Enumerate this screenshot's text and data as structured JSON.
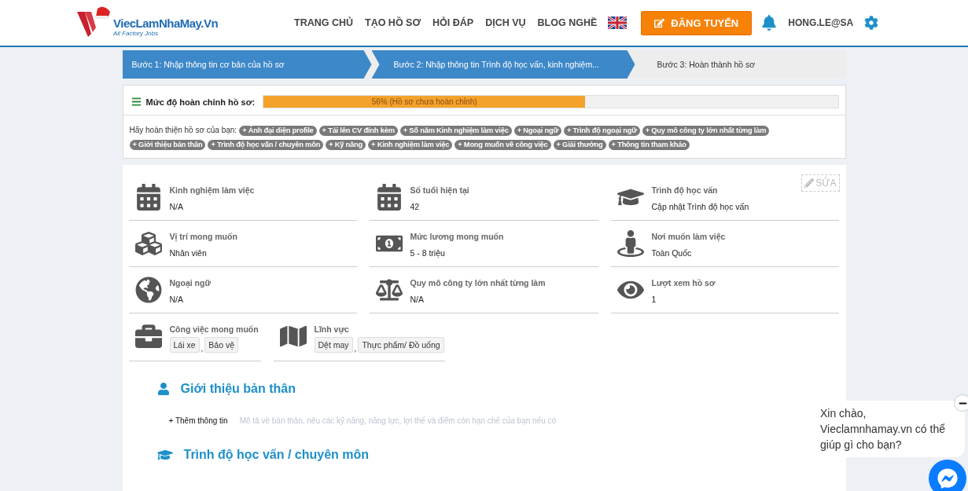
{
  "header": {
    "logo": {
      "name": "ViecLamNhaMay.Vn",
      "tagline": "All Factory Jobs"
    },
    "nav": [
      {
        "label": "TRANG CHỦ"
      },
      {
        "label": "TẠO HỒ SƠ"
      },
      {
        "label": "HỎI ĐÁP"
      },
      {
        "label": "DỊCH VỤ"
      },
      {
        "label": "BLOG NGHỀ"
      }
    ],
    "post_button": "ĐĂNG TUYỂN",
    "user": "HONG.LE@SA"
  },
  "steps": [
    {
      "label": "Bước 1: Nhập thông tin cơ bản của hồ sơ",
      "selected": true
    },
    {
      "label": "Bước 2: Nhập thông tin Trình độ học vấn, kinh nghiệm...",
      "selected": true
    },
    {
      "label": "Bước 3: Hoàn thành hồ sơ",
      "selected": false
    }
  ],
  "completion": {
    "label": "Mức độ hoàn chỉnh hồ sơ:",
    "level": 0.56,
    "reading": "56% (Hồ sơ chưa hoàn chỉnh)",
    "prompt": "Hãy hoàn thiện hồ sơ của bạn:",
    "tags": [
      "+ Ảnh đại diện profile",
      "+ Tải lên CV đính kèm",
      "+ Số năm Kinh nghiệm làm việc",
      "+ Ngoại ngữ",
      "+ Trình độ ngoại ngữ",
      "+ Quy mô công ty lớn nhất từng làm",
      "+ Giới thiệu bản thân",
      "+ Trình độ học vấn / chuyên môn",
      "+ Kỹ năng",
      "+ Kinh nghiệm làm việc",
      "+ Mong muốn về công việc",
      "+ Giải thưởng",
      "+ Thông tin tham khảo"
    ]
  },
  "profile": {
    "edit_button": "SỬA",
    "fields": [
      {
        "label": "Kinh nghiệm làm việc",
        "value": "N/A"
      },
      {
        "label": "Số tuổi hiện tại",
        "value": "42"
      },
      {
        "label": "Trình độ học vấn",
        "value": "Cập nhật Trình độ học vấn"
      },
      {
        "label": "Vị trí mong muốn",
        "value": "Nhân viên"
      },
      {
        "label": "Mức lương mong muốn",
        "value": "5 - 8 triệu"
      },
      {
        "label": "Nơi muốn làm việc",
        "value": "Toàn Quốc"
      },
      {
        "label": "Ngoại ngữ",
        "value": "N/A"
      },
      {
        "label": "Quy mô công ty lớn nhất từng làm",
        "value": "N/A"
      },
      {
        "label": "Lượt xem hồ sơ",
        "value": "1"
      }
    ],
    "tag_fields": [
      {
        "label": "Công việc mong muốn",
        "tags": [
          "Lái xe",
          "Bảo vệ"
        ],
        "separator": ","
      },
      {
        "label": "Lĩnh vực",
        "tags": [
          "Dệt may",
          "Thực phẩm/ Đồ uống"
        ],
        "separator": ","
      }
    ]
  },
  "sections": [
    {
      "title": "Giới thiệu bản thân",
      "add_link": "+ Thêm thông tin",
      "hint": "Mô tả về bản thân, nêu các kỹ năng, năng lực, lợi thế và điểm còn hạn chế của bạn nếu có"
    },
    {
      "title": "Trình độ học vấn / chuyên môn"
    }
  ],
  "chat": {
    "message": "Xin chào, Vieclamnhamay.vn có thể giúp gì cho bạn?"
  }
}
